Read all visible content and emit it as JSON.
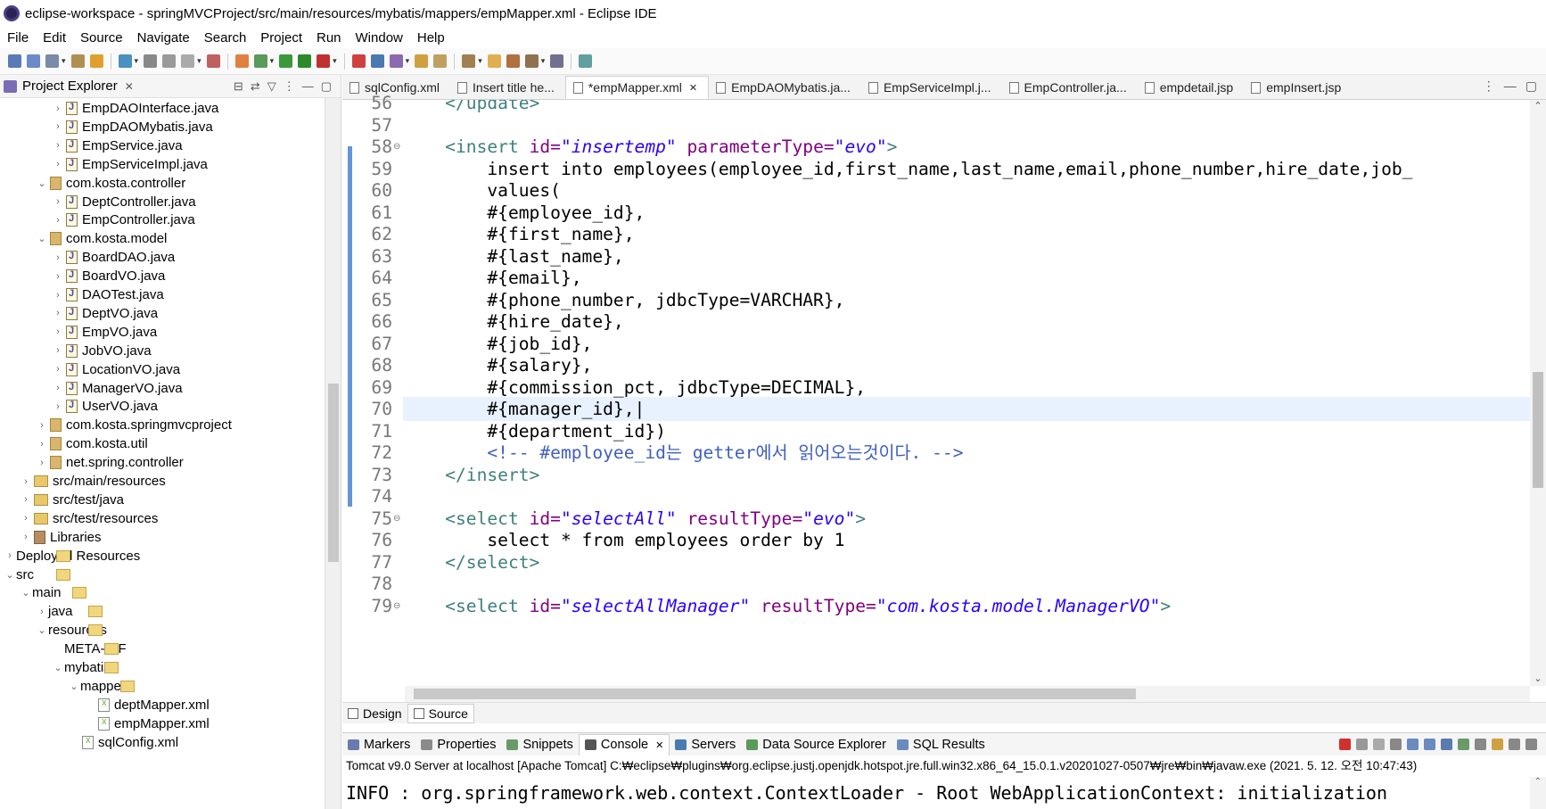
{
  "window": {
    "title": "eclipse-workspace - springMVCProject/src/main/resources/mybatis/mappers/empMapper.xml - Eclipse IDE"
  },
  "menu": [
    "File",
    "Edit",
    "Source",
    "Navigate",
    "Search",
    "Project",
    "Run",
    "Window",
    "Help"
  ],
  "explorer": {
    "title": "Project Explorer",
    "close": "✕",
    "items": [
      {
        "label": "EmpDAOInterface.java",
        "depth": 4,
        "icon": "java-file-icon",
        "arrow": "›"
      },
      {
        "label": "EmpDAOMybatis.java",
        "depth": 4,
        "icon": "java-file-icon",
        "arrow": "›"
      },
      {
        "label": "EmpService.java",
        "depth": 4,
        "icon": "java-file-icon",
        "arrow": "›"
      },
      {
        "label": "EmpServiceImpl.java",
        "depth": 4,
        "icon": "java-file-icon",
        "arrow": "›"
      },
      {
        "label": "com.kosta.controller",
        "depth": 3,
        "icon": "package-icon",
        "arrow": "⌄"
      },
      {
        "label": "DeptController.java",
        "depth": 4,
        "icon": "java-file-icon",
        "arrow": "›"
      },
      {
        "label": "EmpController.java",
        "depth": 4,
        "icon": "java-file-icon",
        "arrow": "›"
      },
      {
        "label": "com.kosta.model",
        "depth": 3,
        "icon": "package-icon",
        "arrow": "⌄"
      },
      {
        "label": "BoardDAO.java",
        "depth": 4,
        "icon": "java-file-icon",
        "arrow": "›"
      },
      {
        "label": "BoardVO.java",
        "depth": 4,
        "icon": "java-file-icon",
        "arrow": "›"
      },
      {
        "label": "DAOTest.java",
        "depth": 4,
        "icon": "java-file-icon",
        "arrow": "›"
      },
      {
        "label": "DeptVO.java",
        "depth": 4,
        "icon": "java-file-icon",
        "arrow": "›"
      },
      {
        "label": "EmpVO.java",
        "depth": 4,
        "icon": "java-file-icon",
        "arrow": "›"
      },
      {
        "label": "JobVO.java",
        "depth": 4,
        "icon": "java-file-icon",
        "arrow": "›"
      },
      {
        "label": "LocationVO.java",
        "depth": 4,
        "icon": "java-file-icon",
        "arrow": "›"
      },
      {
        "label": "ManagerVO.java",
        "depth": 4,
        "icon": "java-file-icon",
        "arrow": "›"
      },
      {
        "label": "UserVO.java",
        "depth": 4,
        "icon": "java-file-icon",
        "arrow": "›"
      },
      {
        "label": "com.kosta.springmvcproject",
        "depth": 3,
        "icon": "package-icon",
        "arrow": "›"
      },
      {
        "label": "com.kosta.util",
        "depth": 3,
        "icon": "package-icon",
        "arrow": "›"
      },
      {
        "label": "net.spring.controller",
        "depth": 3,
        "icon": "package-icon",
        "arrow": "›"
      },
      {
        "label": "src/main/resources",
        "depth": 2,
        "icon": "source-folder-icon",
        "arrow": "›"
      },
      {
        "label": "src/test/java",
        "depth": 2,
        "icon": "source-folder-icon",
        "arrow": "›"
      },
      {
        "label": "src/test/resources",
        "depth": 2,
        "icon": "source-folder-icon",
        "arrow": "›"
      },
      {
        "label": "Libraries",
        "depth": 2,
        "icon": "library-icon",
        "arrow": "›"
      },
      {
        "label": "Deployed Resources",
        "depth": 1,
        "icon": "deployed-icon",
        "arrow": "›"
      },
      {
        "label": "src",
        "depth": 1,
        "icon": "folder-icon",
        "arrow": "⌄"
      },
      {
        "label": "main",
        "depth": 2,
        "icon": "folder-icon",
        "arrow": "⌄"
      },
      {
        "label": "java",
        "depth": 3,
        "icon": "folder-icon",
        "arrow": "›"
      },
      {
        "label": "resources",
        "depth": 3,
        "icon": "folder-icon",
        "arrow": "⌄"
      },
      {
        "label": "META-INF",
        "depth": 4,
        "icon": "folder-icon",
        "arrow": ""
      },
      {
        "label": "mybatis",
        "depth": 4,
        "icon": "folder-icon",
        "arrow": "⌄"
      },
      {
        "label": "mappers",
        "depth": 5,
        "icon": "folder-icon",
        "arrow": "⌄"
      },
      {
        "label": "deptMapper.xml",
        "depth": 6,
        "icon": "xml-file-icon",
        "arrow": ""
      },
      {
        "label": "empMapper.xml",
        "depth": 6,
        "icon": "xml-file-icon",
        "arrow": ""
      },
      {
        "label": "sqlConfig.xml",
        "depth": 5,
        "icon": "xml-file-icon",
        "arrow": ""
      }
    ]
  },
  "tabs": [
    {
      "label": "sqlConfig.xml",
      "active": false
    },
    {
      "label": "Insert title he...",
      "active": false
    },
    {
      "label": "*empMapper.xml",
      "active": true,
      "close": "✕"
    },
    {
      "label": "EmpDAOMybatis.ja...",
      "active": false
    },
    {
      "label": "EmpServiceImpl.j...",
      "active": false
    },
    {
      "label": "EmpController.ja...",
      "active": false
    },
    {
      "label": "empdetail.jsp",
      "active": false
    },
    {
      "label": "empInsert.jsp",
      "active": false
    }
  ],
  "editor": {
    "lines": [
      {
        "n": "56",
        "fold": "",
        "parts": [
          [
            "",
            "    "
          ],
          [
            "tag",
            "</update>"
          ]
        ]
      },
      {
        "n": "57",
        "fold": "",
        "parts": []
      },
      {
        "n": "58",
        "fold": "⊖",
        "parts": [
          [
            "",
            "    "
          ],
          [
            "tag",
            "<insert "
          ],
          [
            "attr",
            "id="
          ],
          [
            "val",
            "\"insertemp\""
          ],
          [
            "attr",
            " parameterType="
          ],
          [
            "val",
            "\"evo\""
          ],
          [
            "tag",
            ">"
          ]
        ]
      },
      {
        "n": "59",
        "fold": "",
        "parts": [
          [
            "",
            "        insert into employees(employee_id,first_name,last_name,email,phone_number,hire_date,job_"
          ]
        ]
      },
      {
        "n": "60",
        "fold": "",
        "parts": [
          [
            "",
            "        values("
          ]
        ]
      },
      {
        "n": "61",
        "fold": "",
        "parts": [
          [
            "",
            "        #{employee_id},"
          ]
        ]
      },
      {
        "n": "62",
        "fold": "",
        "parts": [
          [
            "",
            "        #{first_name},"
          ]
        ]
      },
      {
        "n": "63",
        "fold": "",
        "parts": [
          [
            "",
            "        #{last_name},"
          ]
        ]
      },
      {
        "n": "64",
        "fold": "",
        "parts": [
          [
            "",
            "        #{email},"
          ]
        ]
      },
      {
        "n": "65",
        "fold": "",
        "parts": [
          [
            "",
            "        #{phone_number, jdbcType=VARCHAR},"
          ]
        ]
      },
      {
        "n": "66",
        "fold": "",
        "parts": [
          [
            "",
            "        #{hire_date},"
          ]
        ]
      },
      {
        "n": "67",
        "fold": "",
        "parts": [
          [
            "",
            "        #{job_id},"
          ]
        ]
      },
      {
        "n": "68",
        "fold": "",
        "parts": [
          [
            "",
            "        #{salary},"
          ]
        ]
      },
      {
        "n": "69",
        "fold": "",
        "parts": [
          [
            "",
            "        #{commission_pct, jdbcType=DECIMAL},"
          ]
        ]
      },
      {
        "n": "70",
        "fold": "",
        "parts": [
          [
            "",
            "        #{manager_id},|"
          ]
        ]
      },
      {
        "n": "71",
        "fold": "",
        "parts": [
          [
            "",
            "        #{department_id})"
          ]
        ]
      },
      {
        "n": "72",
        "fold": "",
        "parts": [
          [
            "",
            "        "
          ],
          [
            "cm",
            "<!-- #employee_id는 getter에서 읽어오는것이다. -->"
          ]
        ]
      },
      {
        "n": "73",
        "fold": "",
        "parts": [
          [
            "",
            "    "
          ],
          [
            "tag",
            "</insert>"
          ]
        ]
      },
      {
        "n": "74",
        "fold": "",
        "parts": []
      },
      {
        "n": "75",
        "fold": "⊖",
        "parts": [
          [
            "",
            "    "
          ],
          [
            "tag",
            "<select "
          ],
          [
            "attr",
            "id="
          ],
          [
            "val",
            "\"selectAll\""
          ],
          [
            "attr",
            " resultType="
          ],
          [
            "val",
            "\"evo\""
          ],
          [
            "tag",
            ">"
          ]
        ]
      },
      {
        "n": "76",
        "fold": "",
        "parts": [
          [
            "",
            "        select * from employees order by 1"
          ]
        ]
      },
      {
        "n": "77",
        "fold": "",
        "parts": [
          [
            "",
            "    "
          ],
          [
            "tag",
            "</select>"
          ]
        ]
      },
      {
        "n": "78",
        "fold": "",
        "parts": []
      },
      {
        "n": "79",
        "fold": "⊖",
        "parts": [
          [
            "",
            "    "
          ],
          [
            "tag",
            "<select "
          ],
          [
            "attr",
            "id="
          ],
          [
            "val",
            "\"selectAllManager\""
          ],
          [
            "attr",
            " resultType="
          ],
          [
            "val",
            "\"com.kosta.model.ManagerVO\""
          ],
          [
            "tag",
            ">"
          ]
        ]
      }
    ],
    "highlight_line": "70"
  },
  "design_source": {
    "design": "Design",
    "source": "Source"
  },
  "console": {
    "tabs": [
      "Markers",
      "Properties",
      "Snippets",
      "Console",
      "Servers",
      "Data Source Explorer",
      "SQL Results"
    ],
    "active": "Console",
    "close": "✕",
    "info": "Tomcat v9.0 Server at localhost [Apache Tomcat]  C:₩eclipse₩plugins₩org.eclipse.justj.openjdk.hotspot.jre.full.win32.x86_64_15.0.1.v20201027-0507₩jre₩bin₩javaw.exe  (2021. 5. 12. 오전 10:47:43)",
    "output": "INFO : org.springframework.web.context.ContextLoader - Root WebApplicationContext: initialization"
  },
  "colors": {
    "tag": "#3f7f7f",
    "attr": "#7f007f",
    "val": "#2a00ff",
    "comment": "#3f5fbf",
    "ruler": "#6495d4"
  }
}
